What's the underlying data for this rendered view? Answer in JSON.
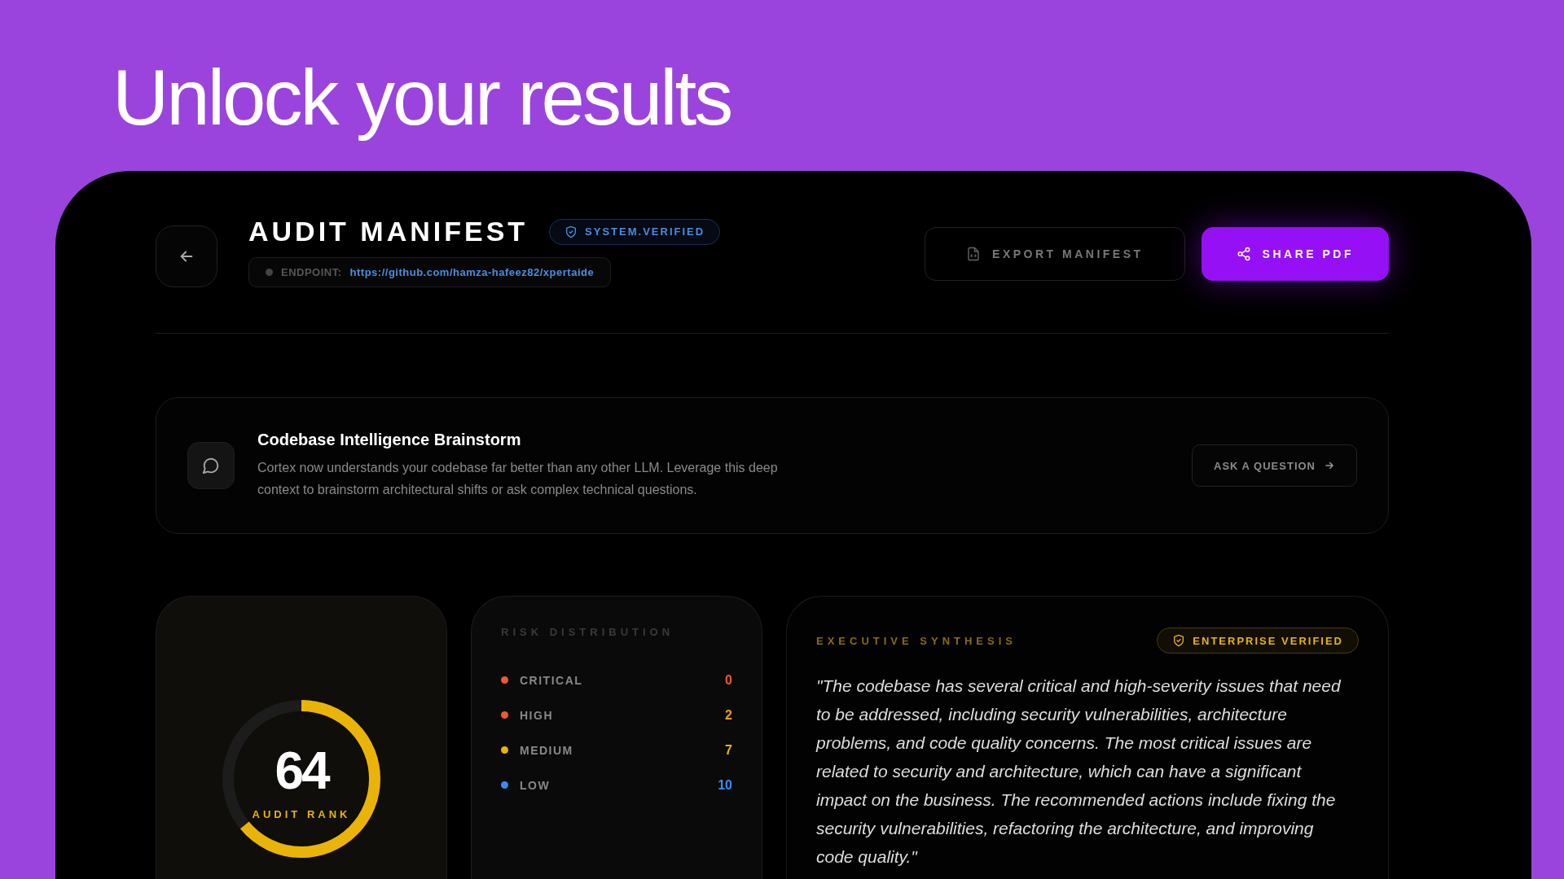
{
  "headline": "Unlock your results",
  "header": {
    "title": "AUDIT MANIFEST",
    "badge": "SYSTEM.VERIFIED",
    "endpoint_label": "ENDPOINT:",
    "endpoint_url": "https://github.com/hamza-hafeez82/xpertaide",
    "actions": [
      {
        "label": "EXPORT MANIFEST",
        "kind": "secondary"
      },
      {
        "label": "SHARE PDF",
        "kind": "primary"
      }
    ]
  },
  "brainstorm": {
    "title": "Codebase Intelligence Brainstorm",
    "description": "Cortex now understands your codebase far better than any other LLM. Leverage this deep context to brainstorm architectural shifts or ask complex technical questions.",
    "button": "ASK A QUESTION"
  },
  "score": {
    "value": "64",
    "label": "AUDIT RANK",
    "level": 0.64
  },
  "risk": {
    "title": "RISK DISTRIBUTION",
    "items": [
      {
        "label": "CRITICAL",
        "count": "0",
        "color": "#f05a2a"
      },
      {
        "label": "HIGH",
        "count": "2",
        "color": "#f05a2a"
      },
      {
        "label": "MEDIUM",
        "count": "7",
        "color": "#eab308"
      },
      {
        "label": "LOW",
        "count": "10",
        "color": "#3b8cf0"
      }
    ]
  },
  "synthesis": {
    "title": "EXECUTIVE SYNTHESIS",
    "badge": "ENTERPRISE VERIFIED",
    "text": "\"The codebase has several critical and high-severity issues that need to be addressed, including security vulnerabilities, architecture problems, and code quality concerns. The most critical issues are related to security and architecture, which can have a significant impact on the business. The recommended actions include fixing the security vulnerabilities, refactoring the architecture, and improving code quality.\""
  }
}
